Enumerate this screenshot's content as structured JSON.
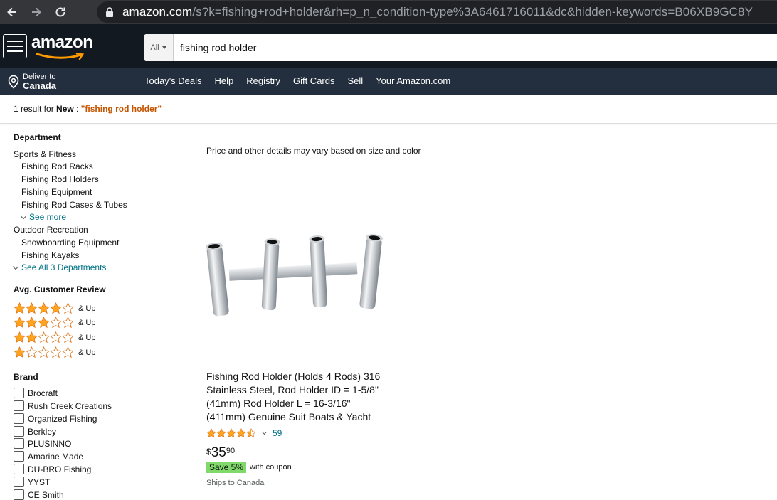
{
  "browser": {
    "url_domain": "amazon.com",
    "url_rest": "/s?k=fishing+rod+holder&rh=p_n_condition-type%3A6461716011&dc&hidden-keywords=B06XB9GC8Y"
  },
  "header": {
    "logo_text": "amazon",
    "search": {
      "category": "All",
      "value": "fishing rod holder"
    },
    "deliver": {
      "line1": "Deliver to",
      "line2": "Canada"
    },
    "nav_links": [
      "Today's Deals",
      "Help",
      "Registry",
      "Gift Cards",
      "Sell",
      "Your Amazon.com"
    ]
  },
  "results_bar": {
    "count_text": "1 result for ",
    "condition": "New",
    "separator": " : ",
    "query": "\"fishing rod holder\""
  },
  "sidebar": {
    "department_title": "Department",
    "departments": {
      "sports": "Sports & Fitness",
      "sports_children": [
        "Fishing Rod Racks",
        "Fishing Rod Holders",
        "Fishing Equipment",
        "Fishing Rod Cases & Tubes"
      ],
      "see_more": "See more",
      "outdoor": "Outdoor Recreation",
      "outdoor_children": [
        "Snowboarding Equipment",
        "Fishing Kayaks"
      ],
      "see_all": "See All 3 Departments"
    },
    "review_title": "Avg. Customer Review",
    "review_rows": [
      {
        "stars": 4,
        "label": "& Up"
      },
      {
        "stars": 3,
        "label": "& Up"
      },
      {
        "stars": 2,
        "label": "& Up"
      },
      {
        "stars": 1,
        "label": "& Up"
      }
    ],
    "brand_title": "Brand",
    "brands": [
      "Brocraft",
      "Rush Creek Creations",
      "Organized Fishing",
      "Berkley",
      "PLUSINNO",
      "Amarine Made",
      "DU-BRO Fishing",
      "YYST",
      "CE Smith"
    ]
  },
  "main": {
    "note": "Price and other details may vary based on size and color",
    "product": {
      "title_lines": [
        "Fishing Rod Holder (Holds 4 Rods) 316",
        "Stainless Steel, Rod Holder ID = 1-5/8\"",
        "(41mm) Rod Holder L = 16-3/16\"",
        "(411mm) Genuine Suit Boats & Yacht"
      ],
      "rating": 4.5,
      "review_count": "59",
      "price_symbol": "$",
      "price_whole": "35",
      "price_fraction": "90",
      "coupon_badge": "Save 5%",
      "coupon_text": "with coupon",
      "shipping": "Ships to Canada"
    }
  },
  "colors": {
    "amazon_dark": "#131921",
    "amazon_nav": "#232f3e",
    "link": "#007185",
    "query": "#c45500",
    "star": "#ffa41c",
    "coupon": "#7fda69"
  }
}
